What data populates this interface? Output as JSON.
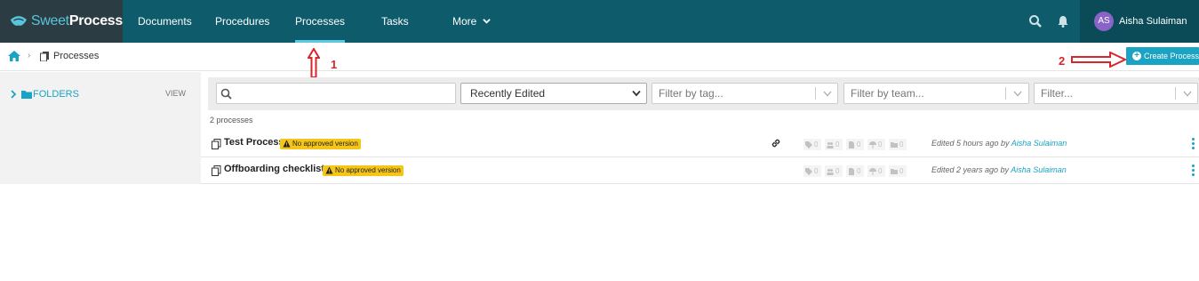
{
  "brand": {
    "name_light": "Sweet",
    "name_bold": "Process"
  },
  "nav": [
    {
      "label": "Documents"
    },
    {
      "label": "Procedures"
    },
    {
      "label": "Processes"
    },
    {
      "label": "Tasks"
    },
    {
      "label": "More"
    }
  ],
  "user": {
    "initials": "AS",
    "name": "Aisha Sulaiman"
  },
  "breadcrumb": {
    "current": "Processes"
  },
  "create_button": "Create Process",
  "annotations": {
    "one": "1",
    "two": "2"
  },
  "sidebar": {
    "folders_label": "FOLDERS",
    "view_label": "VIEW"
  },
  "filters": {
    "search_placeholder": "",
    "sort_value": "Recently Edited",
    "tag_placeholder": "Filter by tag...",
    "team_placeholder": "Filter by team...",
    "other_placeholder": "Filter..."
  },
  "count_label": "2 processes",
  "processes": [
    {
      "title": "Test Process",
      "badge": "No approved version",
      "stats": [
        "0",
        "0",
        "0",
        "0",
        "0"
      ],
      "edited_prefix": "Edited 5 hours ago by",
      "editor": "Aisha Sulaiman"
    },
    {
      "title": "Offboarding checklist",
      "badge": "No approved version",
      "stats": [
        "0",
        "0",
        "0",
        "0",
        "0"
      ],
      "edited_prefix": "Edited 2 years ago by",
      "editor": "Aisha Sulaiman"
    }
  ],
  "colors": {
    "topbar": "#0e5b6b",
    "accent": "#1aa3c2",
    "badge": "#f5c518",
    "annotation": "#d9262c"
  }
}
